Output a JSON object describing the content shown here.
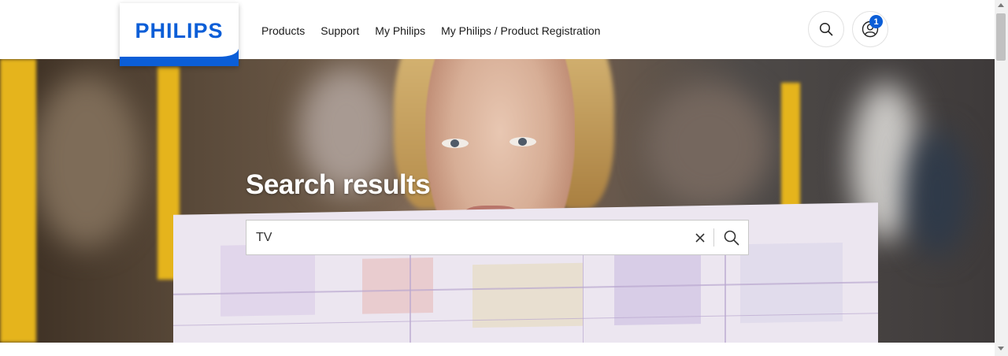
{
  "brand": {
    "logo_text": "PHILIPS",
    "color": "#0b5ed7"
  },
  "nav": {
    "items": [
      {
        "label": "Products"
      },
      {
        "label": "Support"
      },
      {
        "label": "My Philips"
      },
      {
        "label": "My Philips / Product Registration"
      }
    ]
  },
  "header_actions": {
    "search_icon": "search-icon",
    "account_icon": "user-icon",
    "account_badge": "1"
  },
  "hero": {
    "title": "Search results",
    "search": {
      "value": "TV",
      "clear_icon": "close-icon",
      "submit_icon": "search-icon"
    }
  }
}
